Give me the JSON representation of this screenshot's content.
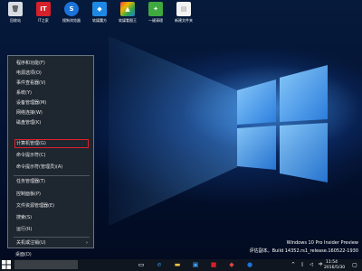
{
  "desktop": {
    "icons": [
      {
        "label": "回收站",
        "icon": "recycle-bin-icon",
        "color": "#d8dde4",
        "glyph": "🗑"
      },
      {
        "label": "IT之家",
        "icon": "ithome-icon",
        "color": "#d6202a",
        "glyph": "IT"
      },
      {
        "label": "搜狗浏览器",
        "icon": "sogou-browser-icon",
        "color": "#1a73d9",
        "glyph": "S"
      },
      {
        "label": "软媒魔方",
        "icon": "ruanmei-cube-icon",
        "color": "#1e88e5",
        "glyph": "◆"
      },
      {
        "label": "软媒看图王",
        "icon": "picture-viewer-icon",
        "color": "#e04646",
        "glyph": "▲"
      },
      {
        "label": "一键清理",
        "icon": "one-click-clean-icon",
        "color": "#3fa83f",
        "glyph": "✦"
      },
      {
        "label": "新建文件夹",
        "icon": "new-folder-icon",
        "color": "#f2f2f2",
        "glyph": "▤"
      }
    ]
  },
  "winx_menu": {
    "items": [
      {
        "label": "程序和功能(F)"
      },
      {
        "label": "电源选项(O)"
      },
      {
        "label": "事件查看器(V)"
      },
      {
        "label": "系统(Y)"
      },
      {
        "label": "设备管理器(M)"
      },
      {
        "label": "网络连接(W)"
      },
      {
        "label": "磁盘管理(K)"
      },
      {
        "label": "计算机管理(G)",
        "highlighted": true
      },
      {
        "label": "命令提示符(C)"
      },
      {
        "label": "命令提示符(管理员)(A)"
      },
      {
        "label": "任务管理器(T)"
      },
      {
        "label": "控制面板(P)"
      },
      {
        "label": "文件资源管理器(E)"
      },
      {
        "label": "搜索(S)"
      },
      {
        "label": "运行(R)"
      },
      {
        "label": "关机或注销(U)",
        "has_submenu": true
      },
      {
        "label": "桌面(D)"
      }
    ],
    "highlight_color": "#e2202a"
  },
  "watermark": {
    "edition": "Windows 10 Pro Insider Preview",
    "build": "评估副本。Build 14352.rs1_release.160522-1930"
  },
  "taskbar": {
    "clock_time": "11:54",
    "clock_date": "2016/5/30",
    "ime": "中"
  }
}
